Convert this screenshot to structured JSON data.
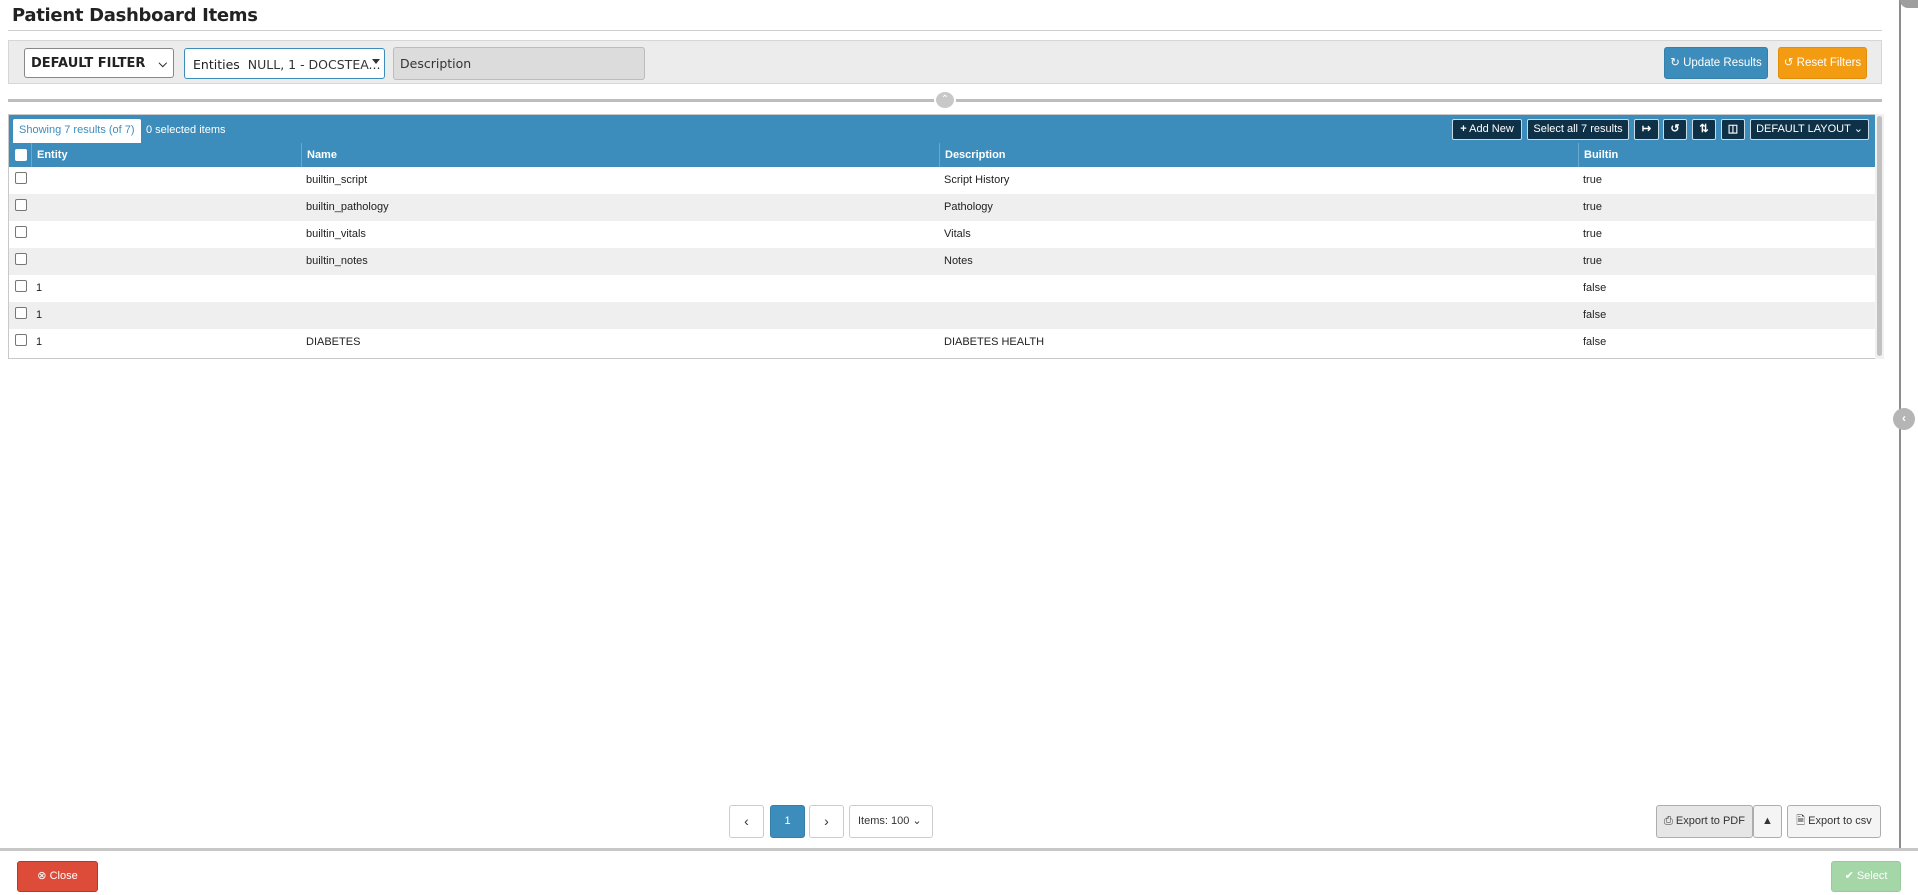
{
  "page": {
    "title": "Patient Dashboard Items"
  },
  "filters": {
    "filter_select": "DEFAULT FILTER",
    "entities_label": "Entities",
    "entities_value": "NULL, 1 - DOCSTEA...",
    "description_placeholder": "Description",
    "update_label": "Update Results",
    "reset_label": "Reset Filters"
  },
  "grid": {
    "showing": "Showing 7 results (of 7)",
    "selected": "0 selected items",
    "add_new": "Add New",
    "select_all": "Select all 7 results",
    "layout": "DEFAULT LAYOUT",
    "columns": [
      "Entity",
      "Name",
      "Description",
      "Builtin"
    ],
    "rows": [
      {
        "entity": "",
        "name": "builtin_script",
        "description": "Script History",
        "builtin": "true"
      },
      {
        "entity": "",
        "name": "builtin_pathology",
        "description": "Pathology",
        "builtin": "true"
      },
      {
        "entity": "",
        "name": "builtin_vitals",
        "description": "Vitals",
        "builtin": "true"
      },
      {
        "entity": "",
        "name": "builtin_notes",
        "description": "Notes",
        "builtin": "true"
      },
      {
        "entity": "1",
        "name": "",
        "description": "",
        "builtin": "false"
      },
      {
        "entity": "1",
        "name": "",
        "description": "",
        "builtin": "false"
      },
      {
        "entity": "1",
        "name": "DIABETES",
        "description": "DIABETES HEALTH",
        "builtin": "false"
      }
    ]
  },
  "pagination": {
    "prev": "‹",
    "page": "1",
    "next": "›",
    "items": "Items: 100"
  },
  "export": {
    "pdf": "Export to PDF",
    "csv": "Export to csv"
  },
  "footer": {
    "close": "Close",
    "select": "Select"
  },
  "colors": {
    "primary": "#3c8dbc",
    "warning": "#f39c12",
    "danger": "#dd4b39",
    "success_disabled": "#a5d6a7",
    "toolbar_button": "#0e3147"
  },
  "icons": [
    "refresh-icon",
    "undo-icon",
    "plus-icon",
    "fit-columns-icon",
    "reset-icon",
    "sort-icon",
    "columns-icon",
    "chevron-down-icon",
    "chevron-up-icon",
    "chevron-left-icon",
    "print-icon",
    "caret-up-icon",
    "csv-file-icon",
    "times-circle-icon",
    "check-circle-icon"
  ]
}
